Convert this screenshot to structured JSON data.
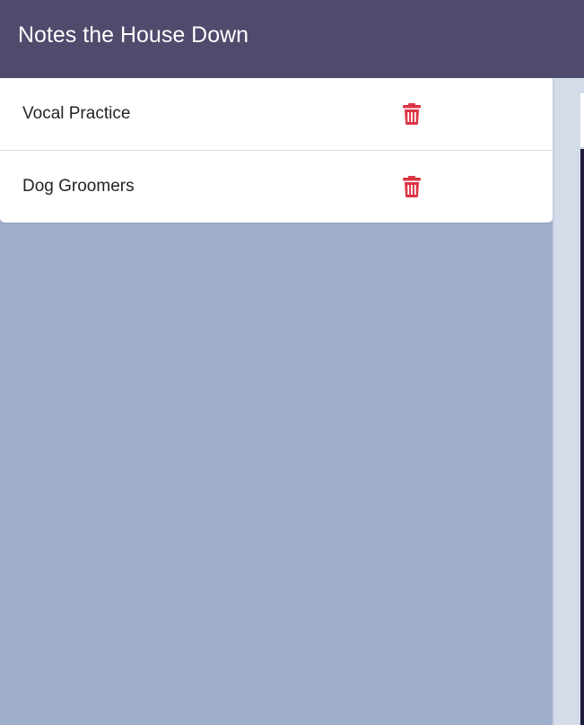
{
  "navbar": {
    "title": "Notes the House Down",
    "background": "#504a6d"
  },
  "notes": [
    {
      "title": "Vocal Practice",
      "delete_icon": "trash-icon"
    },
    {
      "title": "Dog Groomers",
      "delete_icon": "trash-icon"
    }
  ],
  "colors": {
    "sidebar_bg": "#9eaecb",
    "delete_icon": "#dc3545",
    "editor_bg": "#d4dcea",
    "editor_textarea": "#1f1d3d"
  }
}
